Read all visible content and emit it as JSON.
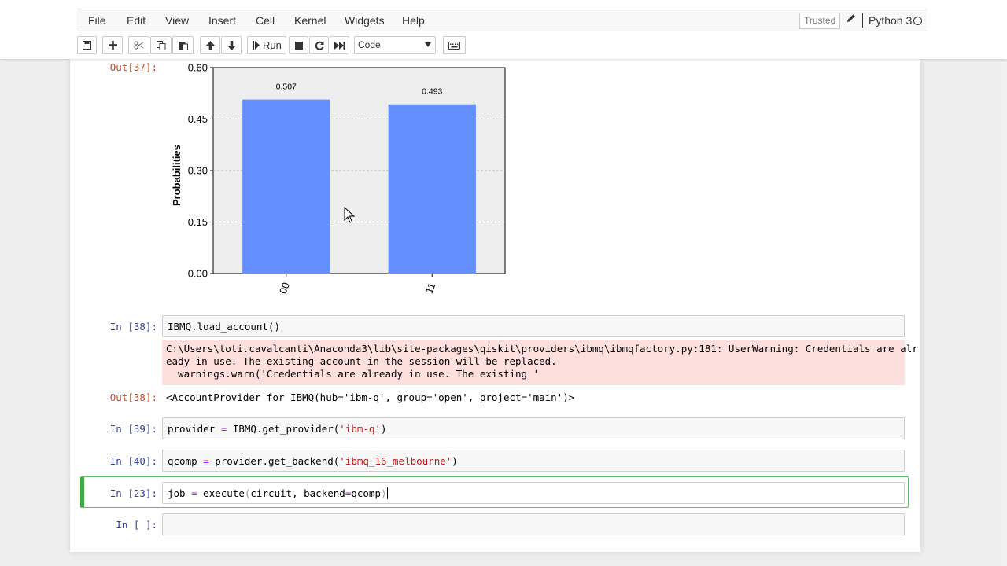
{
  "menu": {
    "items": [
      "File",
      "Edit",
      "View",
      "Insert",
      "Cell",
      "Kernel",
      "Widgets",
      "Help"
    ]
  },
  "status": {
    "trusted": "Trusted",
    "kernel": "Python 3"
  },
  "toolbar": {
    "run_label": "Run",
    "cell_type": "Code",
    "icons": [
      "save-icon",
      "plus-icon",
      "cut-icon",
      "copy-icon",
      "paste-icon",
      "arrow-up-icon",
      "arrow-down-icon",
      "run-icon",
      "stop-icon",
      "restart-icon",
      "fast-forward-icon",
      "keyboard-icon"
    ]
  },
  "cells": {
    "out37": {
      "prompt": "Out[37]:"
    },
    "in38": {
      "prompt": "In [38]:",
      "code": "IBMQ.load_account()",
      "stderr_line1": "C:\\Users\\toti.cavalcanti\\Anaconda3\\lib\\site-packages\\qiskit\\providers\\ibmq\\ibmqfactory.py:181: UserWarning: Credentials are alr",
      "stderr_line2": "eady in use. The existing account in the session will be replaced.",
      "stderr_line3": "  warnings.warn('Credentials are already in use. The existing '",
      "out_prompt": "Out[38]:",
      "out_text": "<AccountProvider for IBMQ(hub='ibm-q', group='open', project='main')>"
    },
    "in39": {
      "prompt": "In [39]:",
      "code_var": "provider",
      "code_op": "=",
      "code_call": "IBMQ.get_provider(",
      "code_str": "'ibm-q'",
      "code_end": ")"
    },
    "in40": {
      "prompt": "In [40]:",
      "code_var": "qcomp",
      "code_op": "=",
      "code_call": "provider.get_backend(",
      "code_str": "'ibmq_16_melbourne'",
      "code_end": ")"
    },
    "in23": {
      "prompt": "In [23]:",
      "code_var": "job",
      "code_op": "=",
      "code_call": "execute",
      "code_paren_open": "(",
      "code_args": "circuit, backend",
      "code_eq": "=",
      "code_arg2": "qcomp",
      "code_paren_close": ")"
    },
    "empty": {
      "prompt": "In [ ]:"
    }
  },
  "chart_data": {
    "type": "bar",
    "categories": [
      "00",
      "11"
    ],
    "values": [
      0.507,
      0.493
    ],
    "value_labels": [
      "0.507",
      "0.493"
    ],
    "ylabel": "Probabilities",
    "ylim": [
      0,
      0.6
    ],
    "yticks": [
      "0.00",
      "0.15",
      "0.30",
      "0.45",
      "0.60"
    ],
    "grid": true,
    "bar_color": "#648fff",
    "background_color": "#eeeeee"
  }
}
